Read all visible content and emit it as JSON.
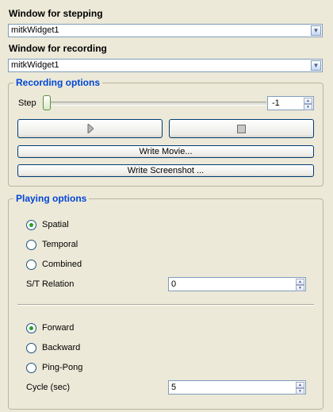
{
  "stepping": {
    "label": "Window for stepping",
    "value": "mitkWidget1"
  },
  "recording": {
    "label": "Window for recording",
    "value": "mitkWidget1"
  },
  "recording_options": {
    "title": "Recording options",
    "step_label": "Step",
    "step_value": "-1",
    "slider_fraction": 0.0,
    "write_movie": "Write Movie...",
    "write_screenshot": "Write Screenshot ..."
  },
  "playing_options": {
    "title": "Playing options",
    "modes": [
      {
        "label": "Spatial",
        "checked": true
      },
      {
        "label": "Temporal",
        "checked": false
      },
      {
        "label": "Combined",
        "checked": false
      }
    ],
    "st_relation_label": "S/T Relation",
    "st_relation_value": "0",
    "directions": [
      {
        "label": "Forward",
        "checked": true
      },
      {
        "label": "Backward",
        "checked": false
      },
      {
        "label": "Ping-Pong",
        "checked": false
      }
    ],
    "cycle_label": "Cycle (sec)",
    "cycle_value": "5"
  },
  "colors": {
    "accent": "#0046d5",
    "background": "#ece9d8"
  }
}
